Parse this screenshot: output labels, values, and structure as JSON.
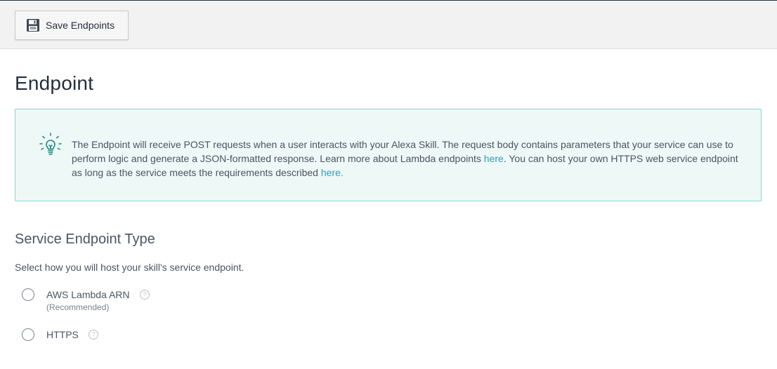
{
  "toolbar": {
    "save_label": "Save Endpoints",
    "save_icon": "floppy-disk-icon"
  },
  "page": {
    "title": "Endpoint"
  },
  "info": {
    "icon": "lightbulb-icon",
    "text_1": "The Endpoint will receive POST requests when a user interacts with your Alexa Skill. The request body contains parameters that your service can use to perform logic and generate a JSON-formatted response. Learn more about Lambda endpoints ",
    "link_1": "here",
    "text_2": ". You can host your own HTTPS web service endpoint as long as the service meets the requirements described ",
    "link_2": "here."
  },
  "service": {
    "title": "Service Endpoint Type",
    "description": "Select how you will host your skill's service endpoint.",
    "options": [
      {
        "label": "AWS Lambda ARN",
        "sublabel": "(Recommended)",
        "help_icon": "?"
      },
      {
        "label": "HTTPS",
        "help_icon": "?"
      }
    ]
  },
  "colors": {
    "accent": "#2e9fbf",
    "info_bg": "#eef8f7",
    "info_border": "#8fd3cb",
    "text": "#232f3e"
  }
}
